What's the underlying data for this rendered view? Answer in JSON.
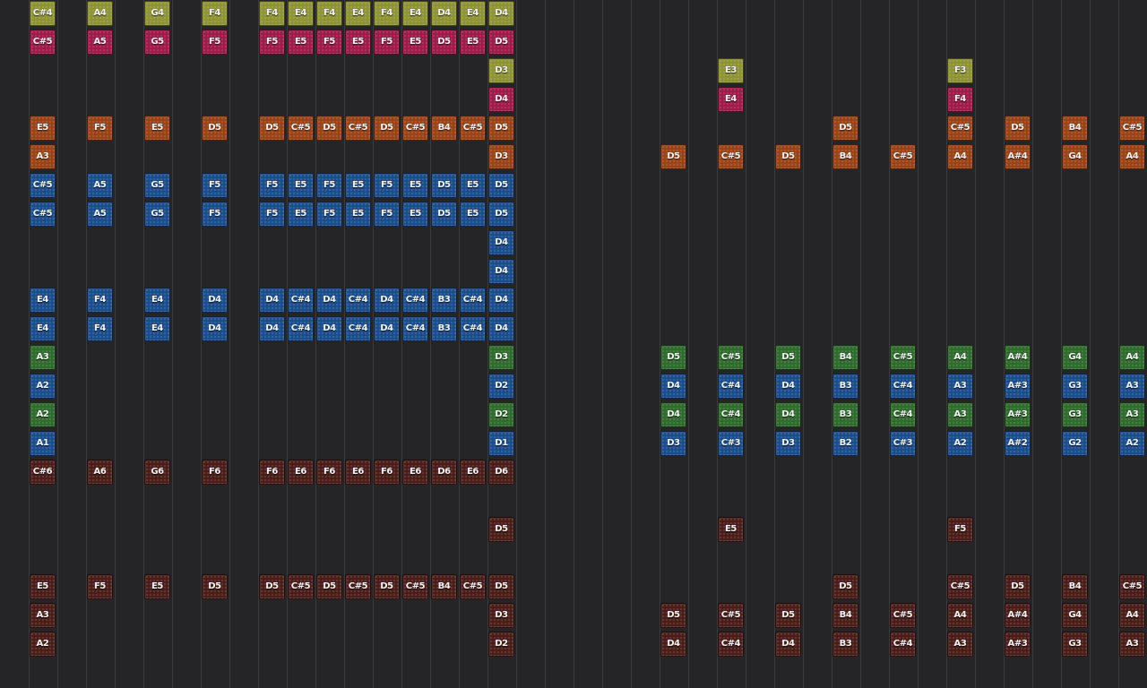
{
  "tracker": {
    "colors": {
      "olive": "#8e9434",
      "magenta": "#a01a4a",
      "orange": "#9a4317",
      "blue": "#1a4d8c",
      "green": "#2e6b2c",
      "brown": "#4b1d18"
    },
    "rows": [
      {
        "color": "olive",
        "cells": {
          "0": "C#4",
          "2": "A4",
          "4": "G4",
          "6": "F4",
          "8": "F4",
          "9": "E4",
          "10": "F4",
          "11": "E4",
          "12": "F4",
          "13": "E4",
          "14": "D4",
          "15": "E4",
          "16": "D4"
        }
      },
      {
        "color": "magenta",
        "cells": {
          "0": "C#5",
          "2": "A5",
          "4": "G5",
          "6": "F5",
          "8": "F5",
          "9": "E5",
          "10": "F5",
          "11": "E5",
          "12": "F5",
          "13": "E5",
          "14": "D5",
          "15": "E5",
          "16": "D5"
        }
      },
      {
        "color": "olive",
        "cells": {
          "16": "D3",
          "24": "E3",
          "32": "F3"
        }
      },
      {
        "color": "magenta",
        "cells": {
          "16": "D4",
          "24": "E4",
          "32": "F4"
        }
      },
      {
        "color": "orange",
        "cells": {
          "0": "E5",
          "2": "F5",
          "4": "E5",
          "6": "D5",
          "8": "D5",
          "9": "C#5",
          "10": "D5",
          "11": "C#5",
          "12": "D5",
          "13": "C#5",
          "14": "B4",
          "15": "C#5",
          "16": "D5",
          "28": "D5",
          "32": "C#5",
          "34": "D5",
          "36": "B4",
          "38": "C#5"
        }
      },
      {
        "color": "orange",
        "cells": {
          "0": "A3",
          "16": "D3",
          "22": "D5",
          "24": "C#5",
          "26": "D5",
          "28": "B4",
          "30": "C#5",
          "32": "A4",
          "34": "A#4",
          "36": "G4",
          "38": "A4"
        }
      },
      {
        "color": "blue",
        "cells": {
          "0": "C#5",
          "2": "A5",
          "4": "G5",
          "6": "F5",
          "8": "F5",
          "9": "E5",
          "10": "F5",
          "11": "E5",
          "12": "F5",
          "13": "E5",
          "14": "D5",
          "15": "E5",
          "16": "D5"
        }
      },
      {
        "color": "blue",
        "cells": {
          "0": "C#5",
          "2": "A5",
          "4": "G5",
          "6": "F5",
          "8": "F5",
          "9": "E5",
          "10": "F5",
          "11": "E5",
          "12": "F5",
          "13": "E5",
          "14": "D5",
          "15": "E5",
          "16": "D5"
        }
      },
      {
        "color": "blue",
        "cells": {
          "16": "D4"
        }
      },
      {
        "color": "blue",
        "cells": {
          "16": "D4"
        }
      },
      {
        "color": "blue",
        "cells": {
          "0": "E4",
          "2": "F4",
          "4": "E4",
          "6": "D4",
          "8": "D4",
          "9": "C#4",
          "10": "D4",
          "11": "C#4",
          "12": "D4",
          "13": "C#4",
          "14": "B3",
          "15": "C#4",
          "16": "D4"
        }
      },
      {
        "color": "blue",
        "cells": {
          "0": "E4",
          "2": "F4",
          "4": "E4",
          "6": "D4",
          "8": "D4",
          "9": "C#4",
          "10": "D4",
          "11": "C#4",
          "12": "D4",
          "13": "C#4",
          "14": "B3",
          "15": "C#4",
          "16": "D4"
        }
      },
      {
        "color": "green",
        "cells": {
          "0": "A3",
          "16": "D3",
          "22": "D5",
          "24": "C#5",
          "26": "D5",
          "28": "B4",
          "30": "C#5",
          "32": "A4",
          "34": "A#4",
          "36": "G4",
          "38": "A4"
        }
      },
      {
        "color": "blue",
        "cells": {
          "0": "A2",
          "16": "D2",
          "22": "D4",
          "24": "C#4",
          "26": "D4",
          "28": "B3",
          "30": "C#4",
          "32": "A3",
          "34": "A#3",
          "36": "G3",
          "38": "A3"
        }
      },
      {
        "color": "green",
        "cells": {
          "0": "A2",
          "16": "D2",
          "22": "D4",
          "24": "C#4",
          "26": "D4",
          "28": "B3",
          "30": "C#4",
          "32": "A3",
          "34": "A#3",
          "36": "G3",
          "38": "A3"
        }
      },
      {
        "color": "blue",
        "cells": {
          "0": "A1",
          "16": "D1",
          "22": "D3",
          "24": "C#3",
          "26": "D3",
          "28": "B2",
          "30": "C#3",
          "32": "A2",
          "34": "A#2",
          "36": "G2",
          "38": "A2"
        }
      },
      {
        "color": "brown",
        "cells": {
          "0": "C#6",
          "2": "A6",
          "4": "G6",
          "6": "F6",
          "8": "F6",
          "9": "E6",
          "10": "F6",
          "11": "E6",
          "12": "F6",
          "13": "E6",
          "14": "D6",
          "15": "E6",
          "16": "D6"
        }
      },
      {
        "color": "brown",
        "cells": {}
      },
      {
        "color": "brown",
        "cells": {
          "16": "D5",
          "24": "E5",
          "32": "F5"
        }
      },
      {
        "color": "brown",
        "cells": {}
      },
      {
        "color": "brown",
        "cells": {
          "0": "E5",
          "2": "F5",
          "4": "E5",
          "6": "D5",
          "8": "D5",
          "9": "C#5",
          "10": "D5",
          "11": "C#5",
          "12": "D5",
          "13": "C#5",
          "14": "B4",
          "15": "C#5",
          "16": "D5",
          "28": "D5",
          "32": "C#5",
          "34": "D5",
          "36": "B4",
          "38": "C#5"
        }
      },
      {
        "color": "brown",
        "cells": {
          "0": "A3",
          "16": "D3",
          "22": "D5",
          "24": "C#5",
          "26": "D5",
          "28": "B4",
          "30": "C#5",
          "32": "A4",
          "34": "A#4",
          "36": "G4",
          "38": "A4"
        }
      },
      {
        "color": "brown",
        "cells": {
          "0": "A2",
          "16": "D2",
          "22": "D4",
          "24": "C#4",
          "26": "D4",
          "28": "B3",
          "30": "C#4",
          "32": "A3",
          "34": "A#3",
          "36": "G3",
          "38": "A3"
        }
      }
    ]
  }
}
